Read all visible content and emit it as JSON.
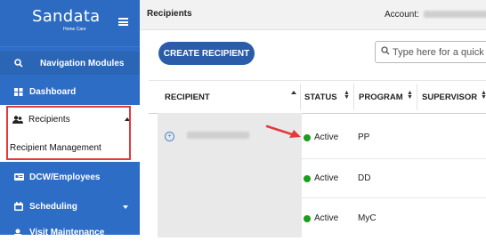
{
  "brand": {
    "logo_text": "Sandata",
    "logo_sub": "Home Care"
  },
  "sidebar": {
    "search_label": "Navigation Modules",
    "items": [
      {
        "label": "Dashboard",
        "icon": "dashboard-icon"
      },
      {
        "label": "Recipients",
        "icon": "recipients-icon"
      },
      {
        "label": "Recipient Management"
      },
      {
        "label": "DCW/Employees",
        "icon": "id-card-icon"
      },
      {
        "label": "Scheduling",
        "icon": "calendar-icon"
      },
      {
        "label": "Visit Maintenance",
        "icon": "visit-icon"
      }
    ]
  },
  "header": {
    "breadcrumb": "Recipients",
    "account_label": "Account:"
  },
  "toolbar": {
    "create_label": "CREATE RECIPIENT",
    "search_placeholder": "Type here for a quick s"
  },
  "table": {
    "columns": [
      "RECIPIENT",
      "STATUS",
      "PROGRAM",
      "SUPERVISOR"
    ],
    "rows": [
      {
        "status": "Active",
        "program": "PP"
      },
      {
        "status": "Active",
        "program": "DD"
      },
      {
        "status": "Active",
        "program": "MyC"
      }
    ]
  },
  "colors": {
    "sidebar": "#2e6dc6",
    "button": "#2a5ca9",
    "active_dot": "#1a9e1a",
    "highlight": "#e23a3a"
  }
}
